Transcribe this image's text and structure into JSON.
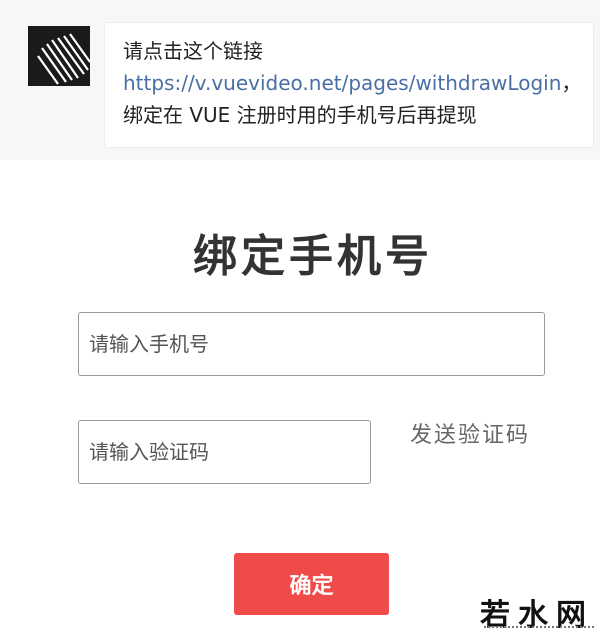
{
  "chat": {
    "text_before": "请点击这个链接 ",
    "link": "https://v.vuevideo.net/pages/withdrawLogin",
    "text_after": "，绑定在 VUE 注册时用的手机号后再提现"
  },
  "form": {
    "title": "绑定手机号",
    "phone_placeholder": "请输入手机号",
    "code_placeholder": "请输入验证码",
    "send_code_label": "发送验证码",
    "confirm_label": "确定"
  },
  "watermark": {
    "text": "若水网"
  },
  "colors": {
    "accent": "#ef4b4b",
    "link": "#4a6fa5",
    "chat_bg": "#f7f7f7"
  }
}
